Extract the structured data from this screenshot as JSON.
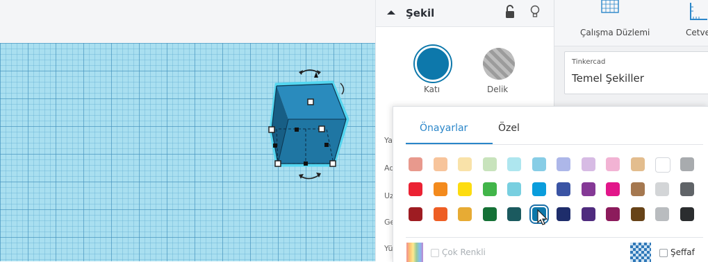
{
  "inspector": {
    "title": "Şekil",
    "solid_label": "Katı",
    "hole_label": "Delik",
    "side_labels": [
      "Ya",
      "Ad",
      "Uz",
      "Ge",
      "Yü"
    ]
  },
  "library": {
    "workplane_label": "Çalışma Düzlemi",
    "ruler_label": "Cetve",
    "category_small": "Tinkercad",
    "category_name": "Temel Şekiller"
  },
  "color_picker": {
    "tabs": [
      "Önayarlar",
      "Özel"
    ],
    "active_tab": "Önayarlar",
    "rows": [
      [
        "#e8998d",
        "#f7c49b",
        "#f9e2a9",
        "#c8e3bc",
        "#aee6ef",
        "#87cde6",
        "#adb7e9",
        "#d7bbe4",
        "#f2b3d4",
        "#e3bd8e",
        "#ffffff",
        "#a8abae"
      ],
      [
        "#eb2233",
        "#f38a1d",
        "#fddc10",
        "#41b549",
        "#78cfe0",
        "#0a9ddc",
        "#3a54a4",
        "#853996",
        "#e2168a",
        "#a57850",
        "#d3d5d7",
        "#606468"
      ],
      [
        "#9e1c22",
        "#ee5e24",
        "#e7ab34",
        "#157136",
        "#1b5a5f",
        "#0d78ab",
        "#1e2d6b",
        "#4f2b7e",
        "#8c1b5c",
        "#674318",
        "#b9bcbf",
        "#2b2d2f"
      ]
    ],
    "selected_color": "#0d78ab",
    "multicolor_label": "Çok Renkli",
    "transparent_label": "Şeffaf"
  },
  "shape": {
    "color": "#1e7fb0"
  }
}
